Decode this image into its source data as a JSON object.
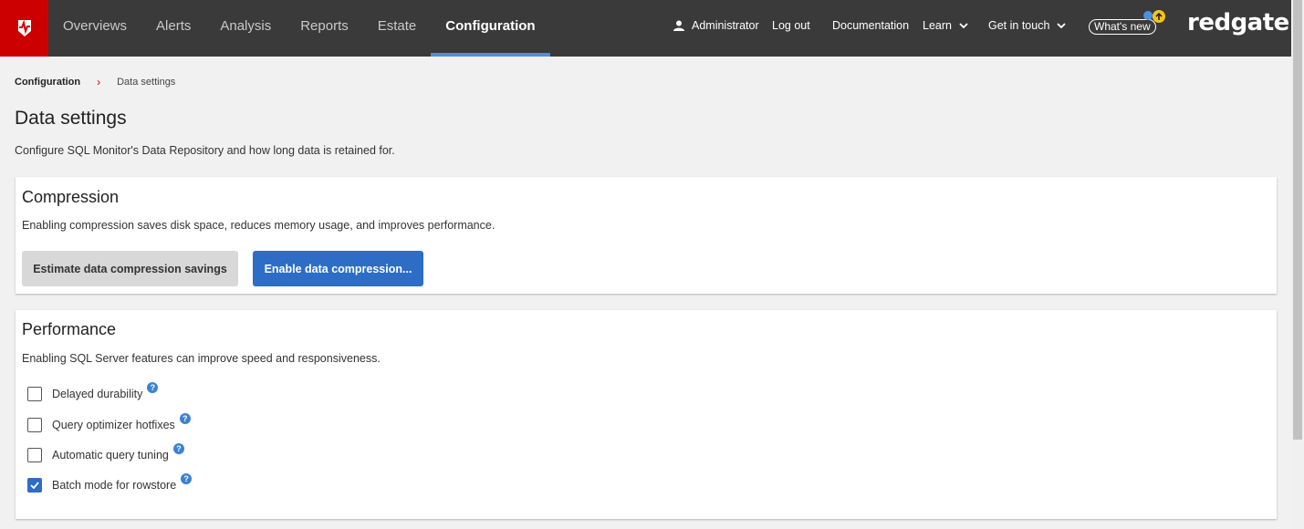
{
  "nav": {
    "items": [
      {
        "label": "Overviews",
        "active": false
      },
      {
        "label": "Alerts",
        "active": false
      },
      {
        "label": "Analysis",
        "active": false
      },
      {
        "label": "Reports",
        "active": false
      },
      {
        "label": "Estate",
        "active": false
      },
      {
        "label": "Configuration",
        "active": true
      }
    ],
    "user": "Administrator",
    "logout": "Log out",
    "documentation": "Documentation",
    "learn": "Learn",
    "get_in_touch": "Get in touch",
    "whats_new": "What's new",
    "brand": "redgate",
    "accent_color": "#4b8fe0",
    "logo_color": "#cc0000"
  },
  "breadcrumb": {
    "root": "Configuration",
    "separator": "›",
    "current": "Data settings"
  },
  "page": {
    "title": "Data settings",
    "description": "Configure SQL Monitor's Data Repository and how long data is retained for."
  },
  "compression": {
    "title": "Compression",
    "description": "Enabling compression saves disk space, reduces memory usage, and improves performance.",
    "estimate_button": "Estimate data compression savings",
    "enable_button": "Enable data compression..."
  },
  "performance": {
    "title": "Performance",
    "description": "Enabling SQL Server features can improve speed and responsiveness.",
    "options": [
      {
        "label": "Delayed durability",
        "checked": false
      },
      {
        "label": "Query optimizer hotfixes",
        "checked": false
      },
      {
        "label": "Automatic query tuning",
        "checked": false
      },
      {
        "label": "Batch mode for rowstore",
        "checked": true
      }
    ],
    "help_glyph": "?"
  }
}
